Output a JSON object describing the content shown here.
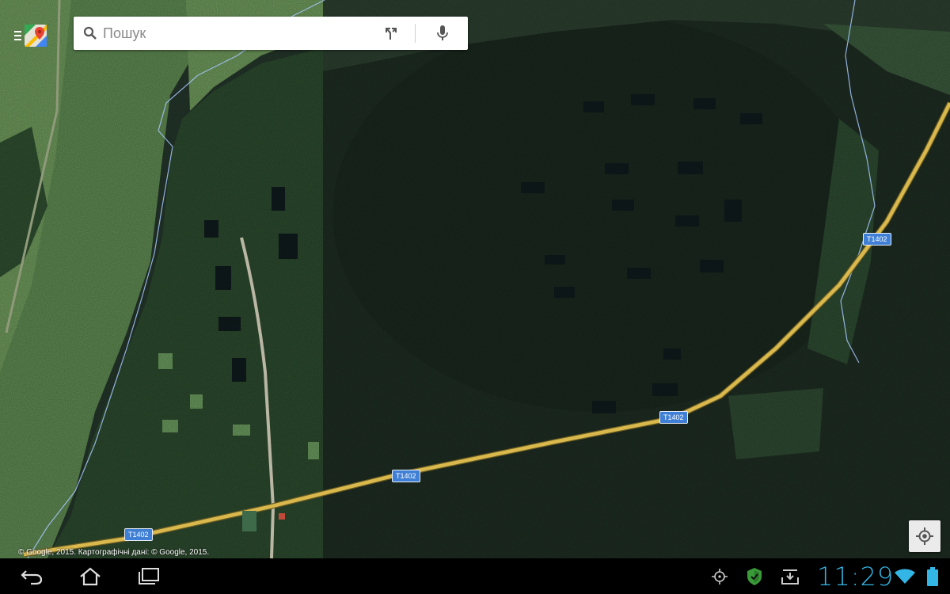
{
  "app": "Google Maps",
  "search": {
    "placeholder": "Пошук"
  },
  "map": {
    "type": "satellite",
    "road_labels": [
      "T1402",
      "T1402",
      "T1402",
      "T1402"
    ],
    "attribution": "© Google, 2015. Картографічні дані: © Google, 2015."
  },
  "status_bar": {
    "time": "11:29"
  },
  "colors": {
    "clock": "#33b5e5",
    "road": "#d9b94d",
    "shield": "#3f7fd5",
    "border_line": "#a8c8ff"
  },
  "icons": {
    "menu": "menu-icon",
    "logo": "maps-logo-icon",
    "search": "search-icon",
    "directions": "directions-icon",
    "mic": "mic-icon",
    "locate": "my-location-icon",
    "back": "back-icon",
    "home": "home-icon",
    "recents": "recent-apps-icon",
    "gps": "gps-status-icon",
    "security": "shield-status-icon",
    "download": "download-status-icon",
    "wifi": "wifi-icon",
    "battery": "battery-icon"
  }
}
